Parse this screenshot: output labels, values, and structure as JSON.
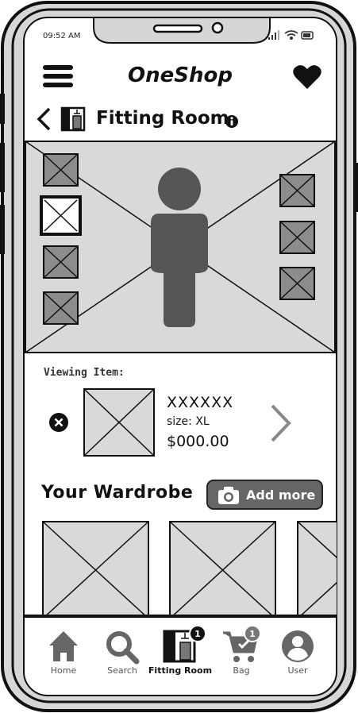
{
  "status_bar": {
    "time": "09:52 AM"
  },
  "header": {
    "title": "OneShop"
  },
  "page": {
    "title": "Fitting Room"
  },
  "viewing": {
    "label": "Viewing Item:",
    "item_name": "XXXXXX",
    "item_size": "size: XL",
    "item_price": "$000.00"
  },
  "wardrobe": {
    "title": "Your Wardrobe",
    "add_label": "Add more"
  },
  "tabbar": {
    "items": [
      {
        "label": "Home",
        "icon": "home-icon"
      },
      {
        "label": "Search",
        "icon": "search-icon"
      },
      {
        "label": "Fitting Room",
        "icon": "fitting-room-icon",
        "badge": "1",
        "active": true
      },
      {
        "label": "Bag",
        "icon": "cart-icon",
        "badge": "1"
      },
      {
        "label": "User",
        "icon": "user-icon"
      }
    ]
  }
}
